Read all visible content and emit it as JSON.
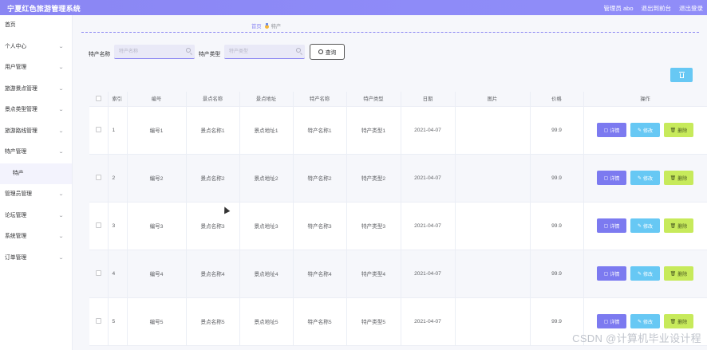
{
  "app": {
    "title": "宁夏红色旅游管理系统",
    "user_label": "管理员 abo",
    "back_label": "退出到前台",
    "logout_label": "退出登录"
  },
  "sidebar": {
    "items": [
      {
        "label": "首页",
        "has_arrow": false
      },
      {
        "label": "个人中心",
        "has_arrow": true
      },
      {
        "label": "用户管理",
        "has_arrow": true
      },
      {
        "label": "旅游景点管理",
        "has_arrow": true
      },
      {
        "label": "景点类型管理",
        "has_arrow": true
      },
      {
        "label": "旅游路线管理",
        "has_arrow": true
      },
      {
        "label": "特产管理",
        "has_arrow": true
      },
      {
        "label": "特产",
        "sub": true
      },
      {
        "label": "管理员管理",
        "has_arrow": true
      },
      {
        "label": "论坛管理",
        "has_arrow": true
      },
      {
        "label": "系统管理",
        "has_arrow": true
      },
      {
        "label": "订单管理",
        "has_arrow": true
      }
    ]
  },
  "breadcrumb": {
    "home": "首页",
    "current": "特产"
  },
  "search": {
    "name_label": "特产名称",
    "name_placeholder": "特产名称",
    "type_label": "特产类型",
    "type_placeholder": "特产类型",
    "button_label": "查询"
  },
  "table": {
    "headers": [
      "",
      "索引",
      "编号",
      "景点名称",
      "景点地址",
      "特产名称",
      "特产类型",
      "日期",
      "图片",
      "价格",
      "操作"
    ],
    "rows": [
      {
        "index": "1",
        "code": "编号1",
        "spot": "景点名称1",
        "addr": "景点地址1",
        "name": "特产名称1",
        "type": "特产类型1",
        "date": "2021-04-07",
        "price": "99.9"
      },
      {
        "index": "2",
        "code": "编号2",
        "spot": "景点名称2",
        "addr": "景点地址2",
        "name": "特产名称2",
        "type": "特产类型2",
        "date": "2021-04-07",
        "price": "99.9"
      },
      {
        "index": "3",
        "code": "编号3",
        "spot": "景点名称3",
        "addr": "景点地址3",
        "name": "特产名称3",
        "type": "特产类型3",
        "date": "2021-04-07",
        "price": "99.9"
      },
      {
        "index": "4",
        "code": "编号4",
        "spot": "景点名称4",
        "addr": "景点地址4",
        "name": "特产名称4",
        "type": "特产类型4",
        "date": "2021-04-07",
        "price": "99.9"
      },
      {
        "index": "5",
        "code": "编号5",
        "spot": "景点名称5",
        "addr": "景点地址5",
        "name": "特产名称5",
        "type": "特产类型5",
        "date": "2021-04-07",
        "price": "99.9"
      }
    ],
    "actions": {
      "detail": "详情",
      "edit": "修改",
      "delete": "删除"
    }
  },
  "watermark": "CSDN @计算机毕业设计程",
  "colors": {
    "accent": "#8a86f3",
    "edit": "#67c8f4",
    "delete": "#c7ea5b",
    "detail": "#7c7af0"
  }
}
